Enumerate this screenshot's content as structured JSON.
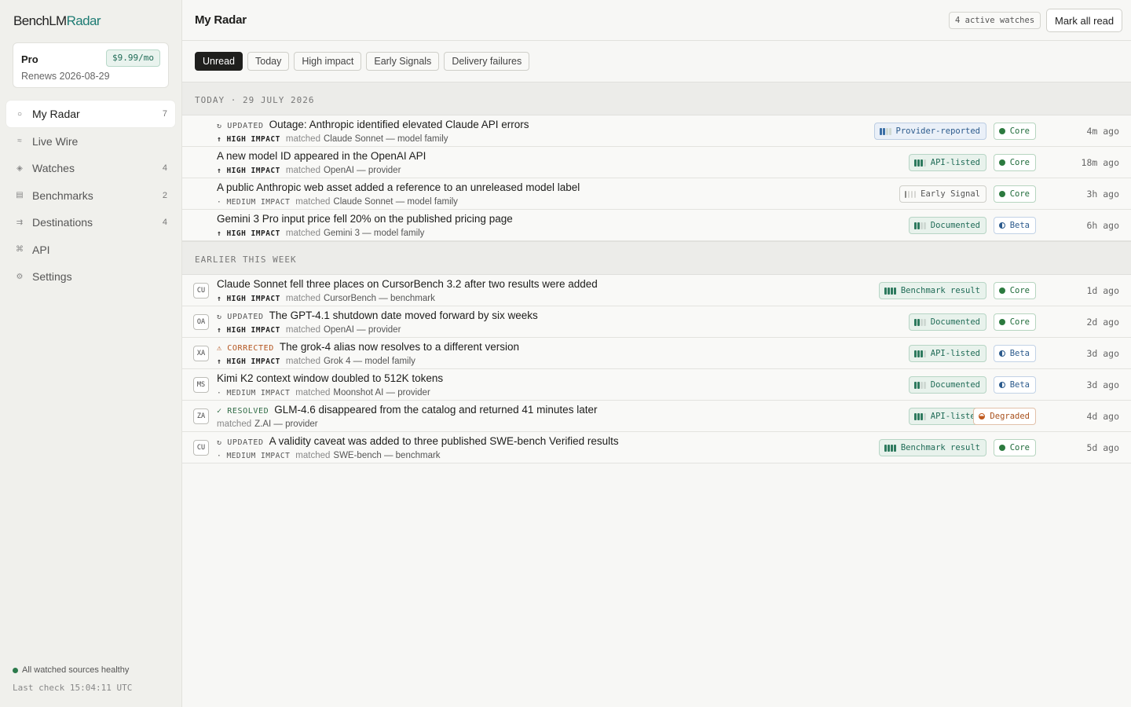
{
  "app": {
    "logo_main": "BenchLM",
    "logo_accent": "Radar"
  },
  "plan": {
    "name": "Pro",
    "price": "$9.99/mo",
    "renews": "Renews 2026-08-29"
  },
  "nav": [
    {
      "label": "My Radar",
      "count": "7",
      "icon": "○"
    },
    {
      "label": "Live Wire",
      "count": "",
      "icon": "≈"
    },
    {
      "label": "Watches",
      "count": "4",
      "icon": "◈"
    },
    {
      "label": "Benchmarks",
      "count": "2",
      "icon": "▤"
    },
    {
      "label": "Destinations",
      "count": "4",
      "icon": "⇉"
    },
    {
      "label": "API",
      "count": "",
      "icon": "⌘"
    },
    {
      "label": "Settings",
      "count": "",
      "icon": "⚙"
    }
  ],
  "footer": {
    "health": "All watched sources healthy",
    "last_check": "Last check 15:04:11 UTC"
  },
  "header": {
    "title": "My Radar",
    "watches_badge": "4 active watches",
    "mark_all_read": "Mark all read"
  },
  "filters": [
    "Unread",
    "Today",
    "High impact",
    "Early Signals",
    "Delivery failures"
  ],
  "sections": [
    {
      "label": "TODAY · 29 JULY 2026",
      "rows": [
        {
          "avatar": "",
          "status": "↻ UPDATED",
          "status_kind": "updated",
          "title": "Outage: Anthropic identified elevated Claude API errors",
          "impact": "↑ HIGH IMPACT",
          "impact_kind": "high",
          "matched": "matched",
          "target": "Claude Sonnet — model family",
          "source": "Provider-reported",
          "source_kind": "blue",
          "source_level": 2,
          "tier": "Core",
          "tier_kind": "core",
          "age": "4m ago"
        },
        {
          "avatar": "",
          "status": "",
          "status_kind": "",
          "title": "A new model ID appeared in the OpenAI API",
          "impact": "↑ HIGH IMPACT",
          "impact_kind": "high",
          "matched": "matched",
          "target": "OpenAI — provider",
          "source": "API-listed",
          "source_kind": "green",
          "source_level": 3,
          "tier": "Core",
          "tier_kind": "core",
          "age": "18m ago"
        },
        {
          "avatar": "",
          "status": "",
          "status_kind": "",
          "title": "A public Anthropic web asset added a reference to an unreleased model label",
          "impact": "· MEDIUM IMPACT",
          "impact_kind": "medium",
          "matched": "matched",
          "target": "Claude Sonnet — model family",
          "source": "Early Signal",
          "source_kind": "grey",
          "source_level": 1,
          "tier": "Core",
          "tier_kind": "core",
          "age": "3h ago"
        },
        {
          "avatar": "",
          "status": "",
          "status_kind": "",
          "title": "Gemini 3 Pro input price fell 20% on the published pricing page",
          "impact": "↑ HIGH IMPACT",
          "impact_kind": "high",
          "matched": "matched",
          "target": "Gemini 3 — model family",
          "source": "Documented",
          "source_kind": "green",
          "source_level": 2,
          "tier": "Beta",
          "tier_kind": "beta",
          "age": "6h ago"
        }
      ]
    },
    {
      "label": "EARLIER THIS WEEK",
      "rows": [
        {
          "avatar": "CU",
          "status": "",
          "status_kind": "",
          "title": "Claude Sonnet fell three places on CursorBench 3.2 after two results were added",
          "impact": "↑ HIGH IMPACT",
          "impact_kind": "high",
          "matched": "matched",
          "target": "CursorBench — benchmark",
          "source": "Benchmark result",
          "source_kind": "green",
          "source_level": 4,
          "tier": "Core",
          "tier_kind": "core",
          "age": "1d ago"
        },
        {
          "avatar": "OA",
          "status": "↻ UPDATED",
          "status_kind": "updated",
          "title": "The GPT-4.1 shutdown date moved forward by six weeks",
          "impact": "↑ HIGH IMPACT",
          "impact_kind": "high",
          "matched": "matched",
          "target": "OpenAI — provider",
          "source": "Documented",
          "source_kind": "green",
          "source_level": 2,
          "tier": "Core",
          "tier_kind": "core",
          "age": "2d ago"
        },
        {
          "avatar": "XA",
          "status": "⚠ CORRECTED",
          "status_kind": "corrected",
          "title": "The grok-4 alias now resolves to a different version",
          "impact": "↑ HIGH IMPACT",
          "impact_kind": "high",
          "matched": "matched",
          "target": "Grok 4 — model family",
          "source": "API-listed",
          "source_kind": "green",
          "source_level": 3,
          "tier": "Beta",
          "tier_kind": "beta",
          "age": "3d ago"
        },
        {
          "avatar": "MS",
          "status": "",
          "status_kind": "",
          "title": "Kimi K2 context window doubled to 512K tokens",
          "impact": "· MEDIUM IMPACT",
          "impact_kind": "medium",
          "matched": "matched",
          "target": "Moonshot AI — provider",
          "source": "Documented",
          "source_kind": "green",
          "source_level": 2,
          "tier": "Beta",
          "tier_kind": "beta",
          "age": "3d ago"
        },
        {
          "avatar": "ZA",
          "status": "✓ RESOLVED",
          "status_kind": "resolved",
          "title": "GLM-4.6 disappeared from the catalog and returned 41 minutes later",
          "impact": "",
          "impact_kind": "",
          "matched": "matched",
          "target": "Z.AI — provider",
          "source": "API-listed",
          "source_kind": "green",
          "source_level": 3,
          "tier": "Degraded",
          "tier_kind": "degraded",
          "age": "4d ago"
        },
        {
          "avatar": "CU",
          "status": "↻ UPDATED",
          "status_kind": "updated",
          "title": "A validity caveat was added to three published SWE-bench Verified results",
          "impact": "· MEDIUM IMPACT",
          "impact_kind": "medium",
          "matched": "matched",
          "target": "SWE-bench — benchmark",
          "source": "Benchmark result",
          "source_kind": "green",
          "source_level": 4,
          "tier": "Core",
          "tier_kind": "core",
          "age": "5d ago"
        }
      ]
    }
  ],
  "colors": {
    "accent": "#1f7c74",
    "bar_green": "#2d7a5e",
    "bar_blue": "#3a6ea5",
    "bar_grey": "#8a8a86",
    "bar_empty": "#cfd9d3",
    "core": "#2c7a3f",
    "beta": "#2b5a8c",
    "degraded": "#c05a1f"
  }
}
